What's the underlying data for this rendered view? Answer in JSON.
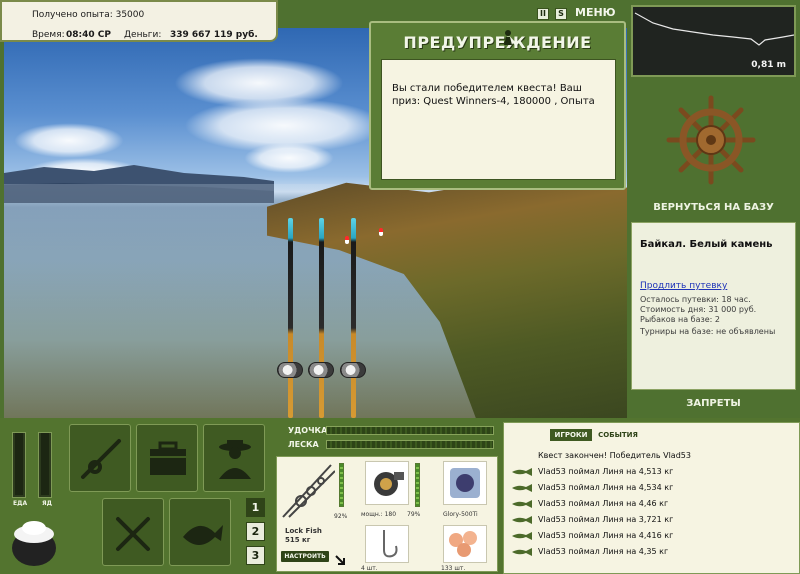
{
  "stats": {
    "exp_text": "Получено опыта: 35000",
    "time_label": "Время:",
    "time_value": "08:40 СР",
    "money_label": "Деньги:",
    "money_value": "339 667 119 руб."
  },
  "top_icons": {
    "pause": "II",
    "s": "S",
    "menu": "МЕНЮ"
  },
  "depth": {
    "value": "0,81 m"
  },
  "warning": {
    "title": "ПРЕДУПРЕЖДЕНИЕ",
    "text": "Вы стали победителем квеста! Ваш приз: Quest Winners-4, 180000 , Опыта"
  },
  "right_panel": {
    "return_label": "ВЕРНУТЬСЯ НА БАЗУ",
    "location": "Байкал. Белый камень",
    "extend_trip": "Продлить путевку",
    "lines": [
      "Осталось путевки: 18 час.",
      "Стоимость дня: 31 000 руб.",
      "Рыбаков на базе: 2",
      "Турниры на базе: не объявлены"
    ],
    "bans_label": "ЗАПРЕТЫ"
  },
  "bottom": {
    "food_label": "ЕДА",
    "poison_label": "ЯД",
    "food_level": 1.0,
    "poison_level": 1.0,
    "slot_buttons": [
      "1",
      "2",
      "3"
    ],
    "active_slot": 0,
    "meters": [
      {
        "label": "УДОЧКА"
      },
      {
        "label": "ЛЕСКА"
      }
    ]
  },
  "tackle": {
    "rod_name": "Lock Fish",
    "rod_weight": "515 кг",
    "rod_pct": "92%",
    "rod_level": 0.92,
    "reel_power": "мощн.: 180",
    "reel_pct": "79%",
    "reel_level": 0.79,
    "line_name": "Glory-500Ti",
    "hook_count": "4 шт.",
    "bait_count": "133 шт.",
    "setup_label": "НАСТРОИТЬ"
  },
  "log": {
    "tab_players": "ИГРОКИ",
    "tab_events": "СОБЫТИЯ",
    "header": "Квест закончен! Победитель Vlad53",
    "entries": [
      "Vlad53 поймал Линя на 4,513 кг",
      "Vlad53 поймал Линя на 4,534 кг",
      "Vlad53 поймал Линя на 4,46 кг",
      "Vlad53 поймал Линя на 3,721 кг",
      "Vlad53 поймал Линя на 4,416 кг",
      "Vlad53 поймал Линя на 4,35 кг"
    ]
  }
}
